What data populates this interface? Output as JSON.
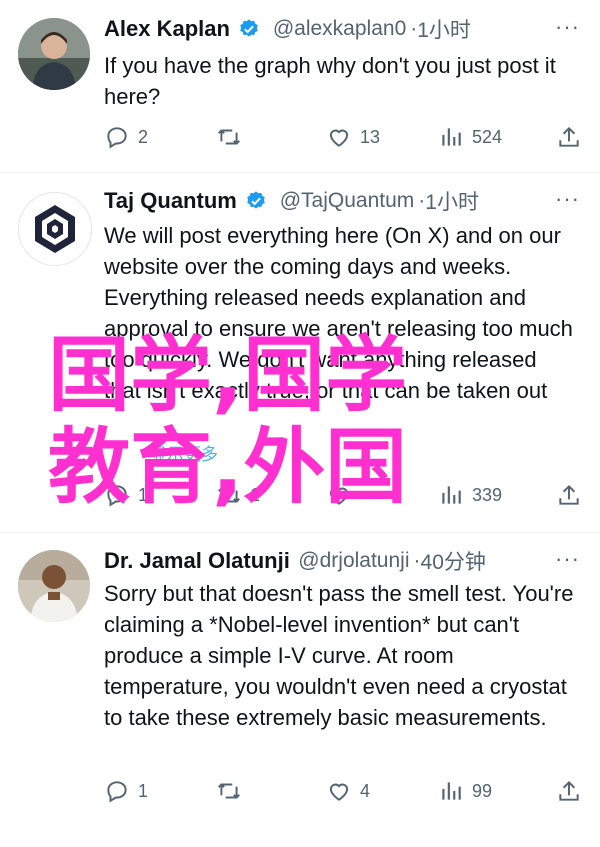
{
  "tweets": [
    {
      "name": "Alex Kaplan",
      "handle": "@alexkaplan0",
      "time": "1小时",
      "text": "If you have the graph why don't you just post it here?",
      "replies": "2",
      "retweets": "",
      "likes": "13",
      "views": "524",
      "avatar_desc": "man-portrait-avatar"
    },
    {
      "name": "Taj Quantum",
      "handle": "@TajQuantum",
      "time": "1小时",
      "text": "We will post everything here (On X) and on our website over the coming days and weeks. Everything released needs explanation and approval to ensure we aren't releasing too much too quickly. We don't want anything released that isn't exactly true, or that can be taken out",
      "translate": "显示更多",
      "replies": "1",
      "retweets": "1",
      "likes": "",
      "views": "339"
    },
    {
      "name": "Dr. Jamal Olatunji",
      "handle": "@drjolatunji",
      "time": "40分钟",
      "text": "Sorry but that doesn't pass the smell test. You're claiming a *Nobel-level invention* but can't produce a simple I-V curve. At room temperature, you wouldn't even need a cryostat to take these extremely basic measurements.",
      "replies": "1",
      "retweets": "",
      "likes": "4",
      "views": "99"
    }
  ],
  "overlay": {
    "line1": "国学,国学",
    "line2": "教育,外国"
  },
  "colors": {
    "verified": "#1d9bf0",
    "meta": "#536471",
    "overlay": "#ff2fd0"
  }
}
